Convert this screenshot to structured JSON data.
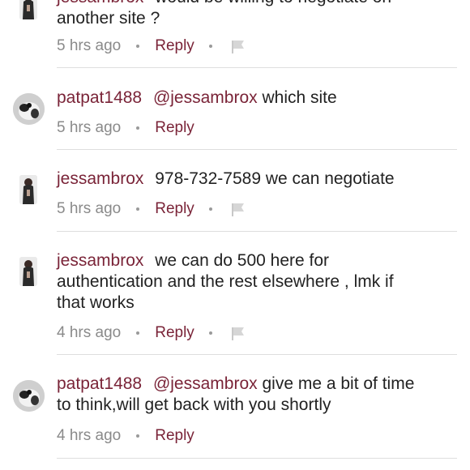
{
  "comments": [
    {
      "username": "jessambrox",
      "mention": "",
      "text_lines": [
        "would be willing to negotiate on",
        "another site ?"
      ],
      "time": "5 hrs ago",
      "reply_label": "Reply",
      "has_flag": true
    },
    {
      "username": "patpat1488",
      "mention": "@jessambrox",
      "text_lines": [
        "which site"
      ],
      "time": "5 hrs ago",
      "reply_label": "Reply",
      "has_flag": false
    },
    {
      "username": "jessambrox",
      "mention": "",
      "text_lines": [
        "978-732-7589 we can negotiate"
      ],
      "time": "5 hrs ago",
      "reply_label": "Reply",
      "has_flag": true
    },
    {
      "username": "jessambrox",
      "mention": "",
      "text_lines": [
        "we can do 500 here for",
        "authentication and the rest elsewhere , lmk if",
        "that works"
      ],
      "time": "4 hrs ago",
      "reply_label": "Reply",
      "has_flag": true
    },
    {
      "username": "patpat1488",
      "mention": "@jessambrox",
      "text_lines": [
        "give me a bit of time",
        "to think,will get back with you shortly"
      ],
      "time": "4 hrs ago",
      "reply_label": "Reply",
      "has_flag": false
    }
  ],
  "colors": {
    "accent": "#7a2438",
    "text": "#222222",
    "muted": "#8a8a8a",
    "divider": "#dedede"
  },
  "icons": {
    "flag": "flag-icon"
  }
}
